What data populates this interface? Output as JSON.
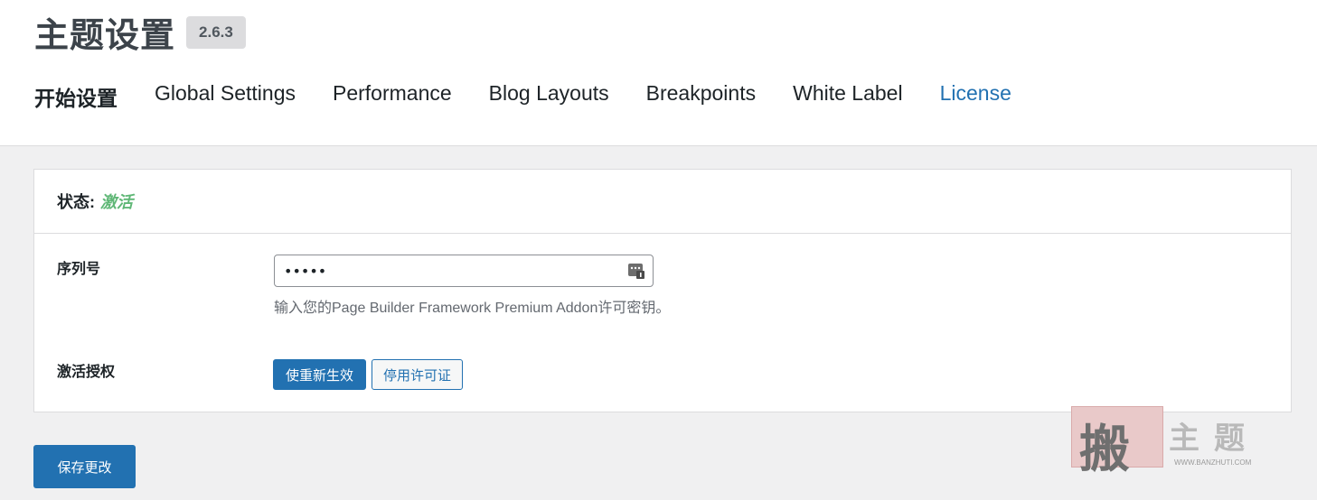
{
  "header": {
    "title": "主题设置",
    "version": "2.6.3"
  },
  "tabs": [
    {
      "label": "开始设置",
      "bold": true
    },
    {
      "label": "Global Settings"
    },
    {
      "label": "Performance"
    },
    {
      "label": "Blog Layouts"
    },
    {
      "label": "Breakpoints"
    },
    {
      "label": "White Label"
    },
    {
      "label": "License",
      "active": true
    }
  ],
  "license_card": {
    "status_label": "状态:",
    "status_value": "激活",
    "serial_label": "序列号",
    "serial_value": "•••••",
    "serial_hint": "输入您的Page Builder Framework Premium Addon许可密钥。",
    "activation_label": "激活授权",
    "reactivate_button": "使重新生效",
    "deactivate_button": "停用许可证"
  },
  "footer": {
    "save_button": "保存更改"
  },
  "watermark": {
    "glyph": "搬",
    "text": "主题",
    "url": "WWW.BANZHUTI.COM"
  },
  "colors": {
    "accent": "#2271b1",
    "status_active": "#5fb776"
  }
}
